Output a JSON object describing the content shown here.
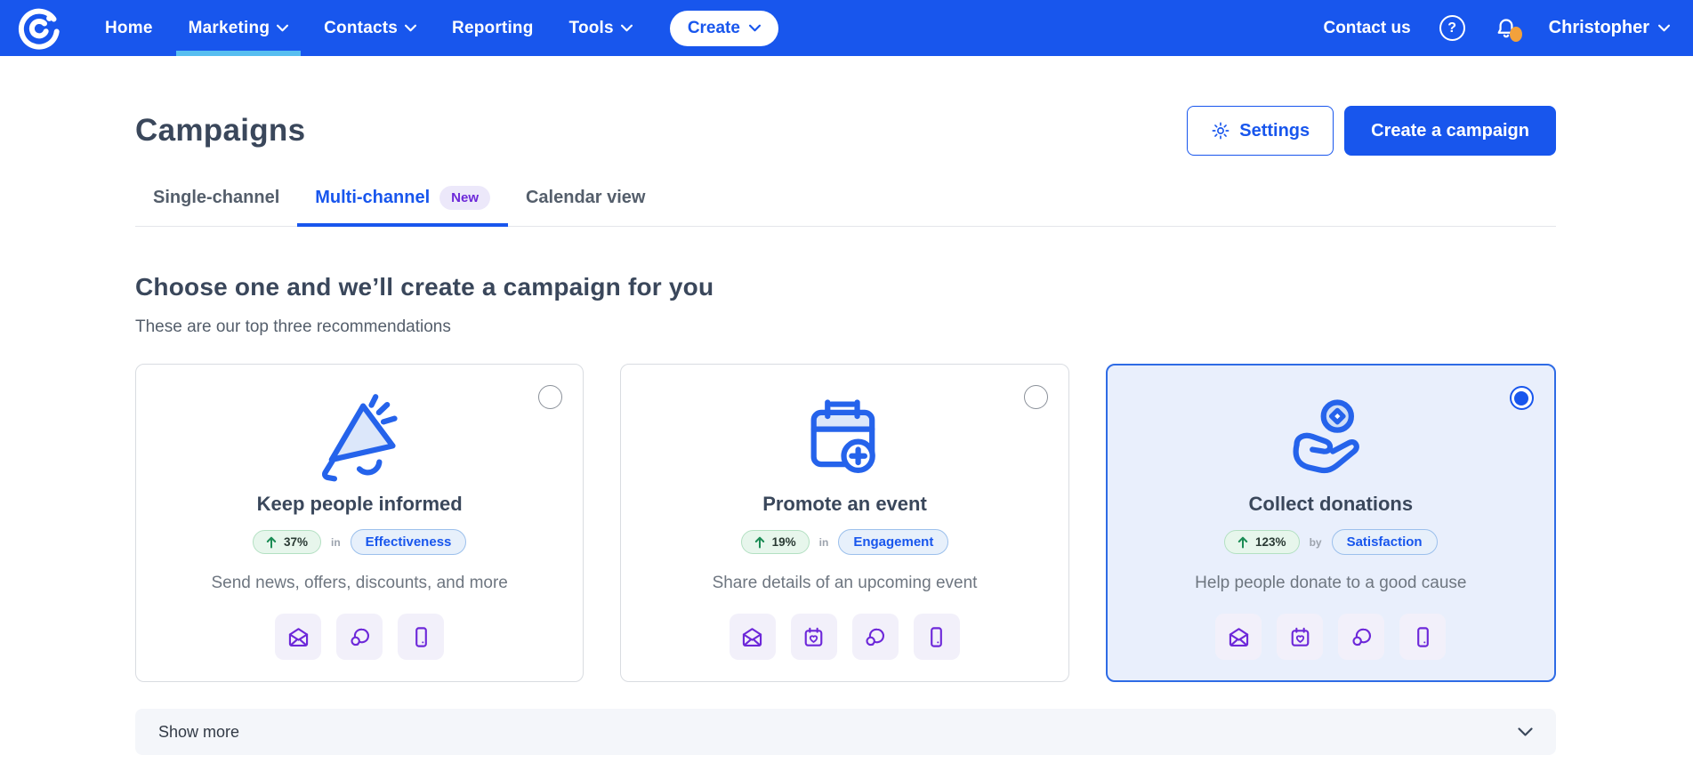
{
  "colors": {
    "primary_blue": "#1856ED",
    "nav_active_underline": "#57BEF0",
    "notification_dot_orange": "#F2A13C",
    "badge_purple": "#6D28D9",
    "stat_green": "#1B8C55",
    "selected_card_bg": "#E9EFFC",
    "channel_icon_purple": "#6D28D9"
  },
  "icons": {
    "brand_logo": "constant-contact-mark",
    "nav_dropdowns": "chevron-down",
    "help": "question-circle",
    "notifications": "bell-with-orange-dot",
    "settings": "gear",
    "card_illustrations": [
      "megaphone",
      "calendar-plus",
      "hand-holding-coin"
    ],
    "channel_icons": [
      "open-envelope",
      "calendar-heart",
      "chat-bubbles",
      "mobile-phone"
    ],
    "trend": "arrow-up",
    "show_more": "chevron-down"
  },
  "nav": {
    "items": [
      {
        "label": "Home"
      },
      {
        "label": "Marketing",
        "active": true,
        "has_dropdown": true
      },
      {
        "label": "Contacts",
        "has_dropdown": true
      },
      {
        "label": "Reporting"
      },
      {
        "label": "Tools",
        "has_dropdown": true
      }
    ],
    "create_label": "Create",
    "contact_us": "Contact us",
    "help_glyph": "?",
    "user_name": "Christopher",
    "notification_dot": true
  },
  "header": {
    "title": "Campaigns",
    "settings_label": "Settings",
    "create_campaign_label": "Create a campaign"
  },
  "tabs": [
    {
      "label": "Single-channel"
    },
    {
      "label": "Multi-channel",
      "badge": "New",
      "active": true
    },
    {
      "label": "Calendar view"
    }
  ],
  "section": {
    "heading": "Choose one and we’ll create a campaign for you",
    "subheading": "These are our top three recommendations"
  },
  "cards": [
    {
      "title": "Keep people informed",
      "stat": "37%",
      "connector": "in",
      "category": "Effectiveness",
      "description": "Send news, offers, discounts, and more",
      "channels": [
        "email",
        "chat",
        "phone"
      ],
      "selected": false,
      "illustration": "megaphone"
    },
    {
      "title": "Promote an event",
      "stat": "19%",
      "connector": "in",
      "category": "Engagement",
      "description": "Share details of an upcoming event",
      "channels": [
        "email",
        "calendar",
        "chat",
        "phone"
      ],
      "selected": false,
      "illustration": "calendar-plus"
    },
    {
      "title": "Collect donations",
      "stat": "123%",
      "connector": "by",
      "category": "Satisfaction",
      "description": "Help people donate to a good cause",
      "channels": [
        "email",
        "calendar",
        "chat",
        "phone"
      ],
      "selected": true,
      "illustration": "hand-holding-coin"
    }
  ],
  "show_more": {
    "label": "Show more"
  }
}
